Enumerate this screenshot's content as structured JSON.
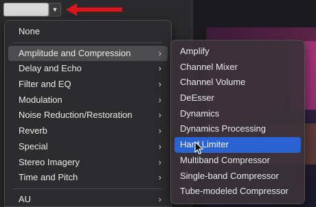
{
  "slot": {
    "button_glyph": "▼"
  },
  "main_menu": {
    "items": [
      {
        "id": "none",
        "label": "None",
        "has_submenu": false
      },
      {
        "id": "amplitude",
        "label": "Amplitude and Compression",
        "has_submenu": true,
        "open": true
      },
      {
        "id": "delay",
        "label": "Delay and Echo",
        "has_submenu": true
      },
      {
        "id": "filter",
        "label": "Filter and EQ",
        "has_submenu": true
      },
      {
        "id": "modulation",
        "label": "Modulation",
        "has_submenu": true
      },
      {
        "id": "noise",
        "label": "Noise Reduction/Restoration",
        "has_submenu": true
      },
      {
        "id": "reverb",
        "label": "Reverb",
        "has_submenu": true
      },
      {
        "id": "special",
        "label": "Special",
        "has_submenu": true
      },
      {
        "id": "stereo",
        "label": "Stereo Imagery",
        "has_submenu": true
      },
      {
        "id": "time",
        "label": "Time and Pitch",
        "has_submenu": true
      },
      {
        "id": "au",
        "label": "AU",
        "has_submenu": true
      }
    ],
    "chevron": "›"
  },
  "sub_menu": {
    "items": [
      {
        "label": "Amplify"
      },
      {
        "label": "Channel Mixer"
      },
      {
        "label": "Channel Volume"
      },
      {
        "label": "DeEsser"
      },
      {
        "label": "Dynamics"
      },
      {
        "label": "Dynamics Processing"
      },
      {
        "label": "Hard Limiter",
        "highlighted": true
      },
      {
        "label": "Multiband Compressor"
      },
      {
        "label": "Single-band Compressor"
      },
      {
        "label": "Tube-modeled Compressor"
      }
    ]
  },
  "colors": {
    "highlight": "#2a63d1",
    "annotation_arrow": "#e0141b"
  }
}
